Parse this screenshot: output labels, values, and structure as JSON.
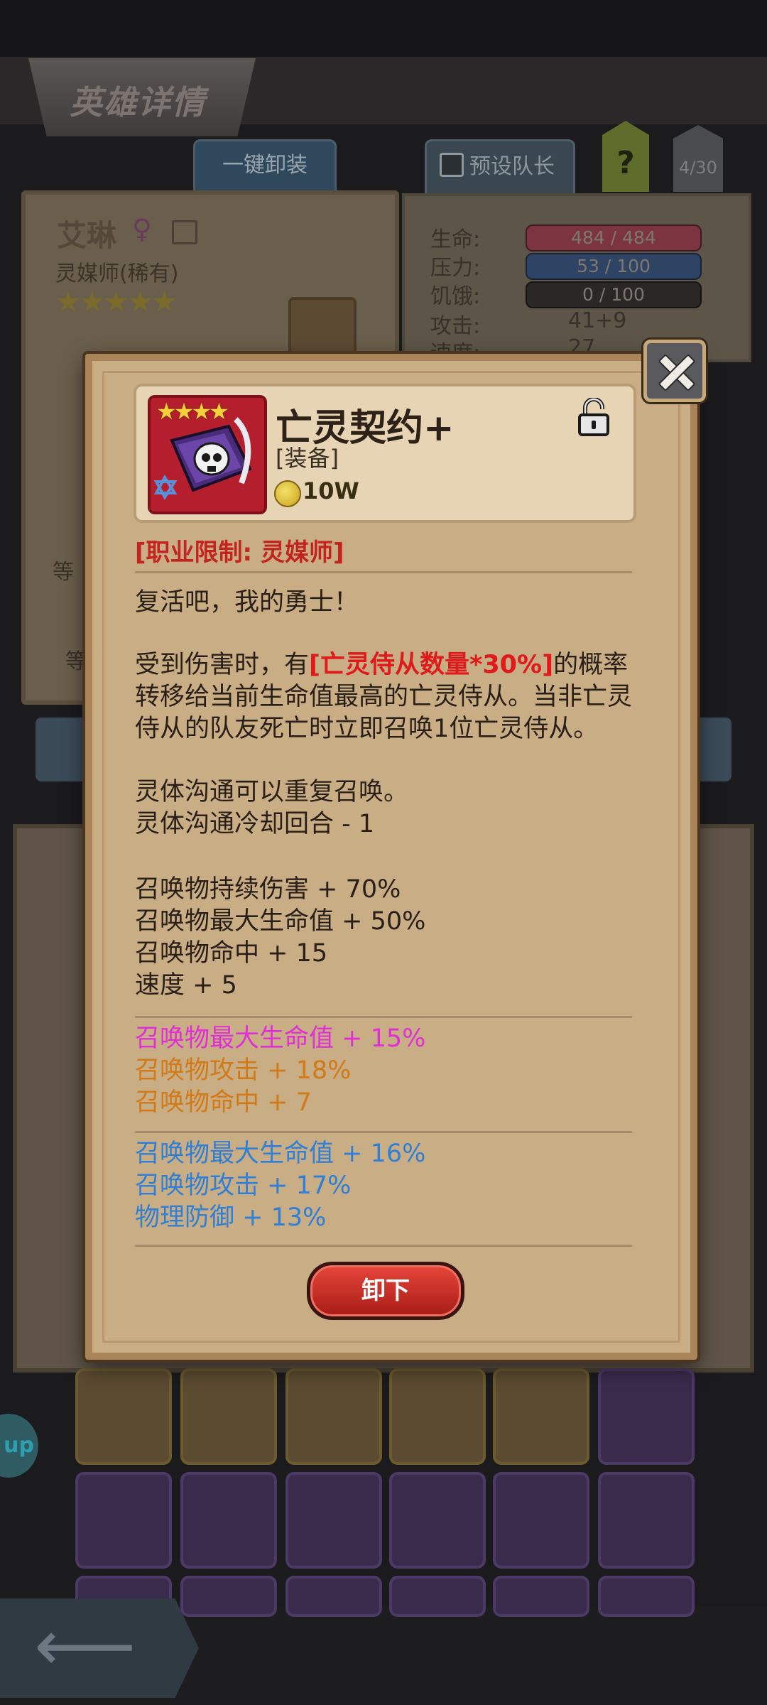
{
  "screen": {
    "header_title": "英雄详情",
    "unequip_all_label": "一键卸装",
    "preset_leader_label": "预设队长",
    "help_label": "?",
    "team_count": "4/30",
    "side_button_label": "up"
  },
  "hero": {
    "name": "艾琳",
    "class": "灵媒师(稀有)",
    "stars": "★★★★★",
    "gender_icon": "female-icon",
    "partial_labels": [
      "等",
      "等"
    ]
  },
  "stats": [
    {
      "label": "生命:",
      "bar_text": "484 / 484",
      "color": "#7b3440"
    },
    {
      "label": "压力:",
      "bar_text": "53 / 100",
      "color": "#2f4364"
    },
    {
      "label": "饥饿:",
      "bar_text": "0 / 100",
      "color": "#2a2726"
    },
    {
      "label": "攻击:",
      "value": "41+9"
    },
    {
      "label": "速度:",
      "value": "27"
    }
  ],
  "item": {
    "name": "亡灵契约+",
    "type": "[装备]",
    "price": "10W",
    "stars": "★★★★",
    "icon": "skull-book-icon",
    "lock_icon": "lock-open-icon",
    "class_restriction": "[职业限制: 灵媒师]",
    "flavor": "复活吧，我的勇士！",
    "effect_prefix": "受到伤害时，有",
    "effect_highlight": "[亡灵侍从数量*30%]",
    "effect_suffix": "的概率转移给当前生命值最高的亡灵侍从。当非亡灵侍从的队友死亡时立即召唤1位亡灵侍从。",
    "effect_lines": [
      "灵体沟通可以重复召唤。",
      "灵体沟通冷却回合 - 1"
    ],
    "base_stats": [
      "召唤物持续伤害 + 70%",
      "召唤物最大生命值 + 50%",
      "召唤物命中 + 15",
      "速度 + 5"
    ],
    "bonus_stats_1": [
      {
        "text": "召唤物最大生命值 + 15%",
        "color": "#e02fd6"
      },
      {
        "text": "召唤物攻击 + 18%",
        "color": "#d17a17"
      },
      {
        "text": "召唤物命中 + 7",
        "color": "#d17a17"
      }
    ],
    "bonus_stats_2": [
      {
        "text": "召唤物最大生命值 + 16%",
        "color": "#2f7fd6"
      },
      {
        "text": "召唤物攻击 + 17%",
        "color": "#2f7fd6"
      },
      {
        "text": "物理防御 + 13%",
        "color": "#2f7fd6"
      }
    ],
    "unequip_label": "卸下"
  },
  "inventory": {
    "row1": [
      "scythe-icon",
      "armor-icon",
      "armor-icon",
      "spyglass-icon",
      "bottle-icon",
      "whip-icon"
    ],
    "row2": [
      "whip-icon",
      "dark-armor-icon",
      "dark-armor-icon",
      "claw-necklace-icon",
      "claw-necklace-icon",
      "ring-icon"
    ]
  }
}
